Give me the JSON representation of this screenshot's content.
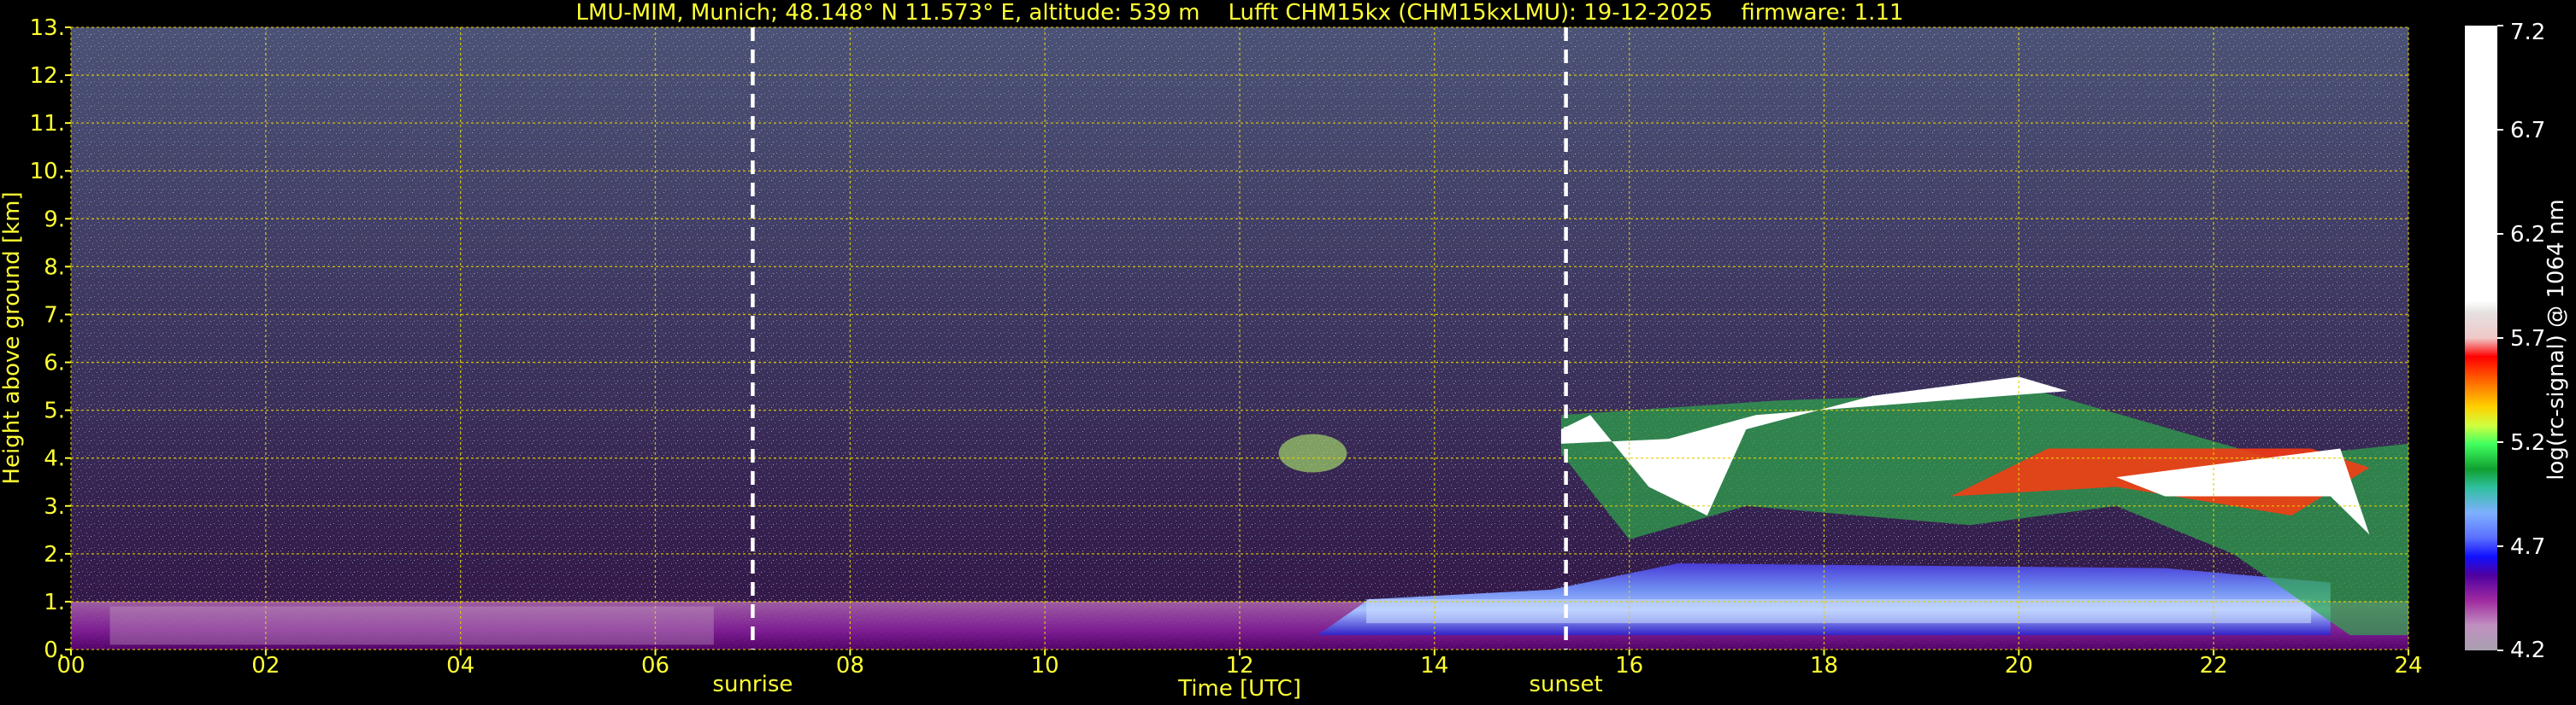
{
  "chart_data": {
    "type": "heatmap",
    "title": "LMU-MIM, Munich; 48.148° N 11.573° E, altitude: 539 m    Lufft CHM15kx (CHM15kxLMU): 19-12-2025    firmware: 1.11",
    "xlabel": "Time [UTC]",
    "ylabel": "Height above ground [km]",
    "xlim": [
      0,
      24
    ],
    "ylim": [
      0,
      13
    ],
    "x_ticks": [
      "00",
      "02",
      "04",
      "06",
      "08",
      "10",
      "12",
      "14",
      "16",
      "18",
      "20",
      "22",
      "24"
    ],
    "y_ticks": [
      "0.",
      "1.",
      "2.",
      "3.",
      "4.",
      "5.",
      "6.",
      "7.",
      "8.",
      "9.",
      "10.",
      "11.",
      "12.",
      "13."
    ],
    "grid": true,
    "annotations": [
      {
        "label": "sunrise",
        "x": 7.0
      },
      {
        "label": "sunset",
        "x": 15.35
      }
    ],
    "colorbar": {
      "label": "log(rc-signal) @ 1064 nm",
      "range": [
        4.2,
        7.2
      ],
      "ticks": [
        "7.2",
        "6.7",
        "6.2",
        "5.7",
        "5.2",
        "4.7",
        "4.2"
      ]
    },
    "features": [
      {
        "name": "boundary layer aerosol",
        "x": [
          0,
          24
        ],
        "height": [
          0.0,
          1.0
        ]
      },
      {
        "name": "enhanced aerosol layer",
        "x": [
          12.8,
          23.2
        ],
        "height": [
          0.3,
          1.8
        ]
      },
      {
        "name": "cloud layer",
        "x": [
          15.3,
          24.0
        ],
        "height": [
          2.2,
          5.8
        ]
      },
      {
        "name": "thin cloud",
        "x": [
          12.4,
          13.1
        ],
        "height": [
          3.7,
          4.5
        ]
      }
    ]
  }
}
